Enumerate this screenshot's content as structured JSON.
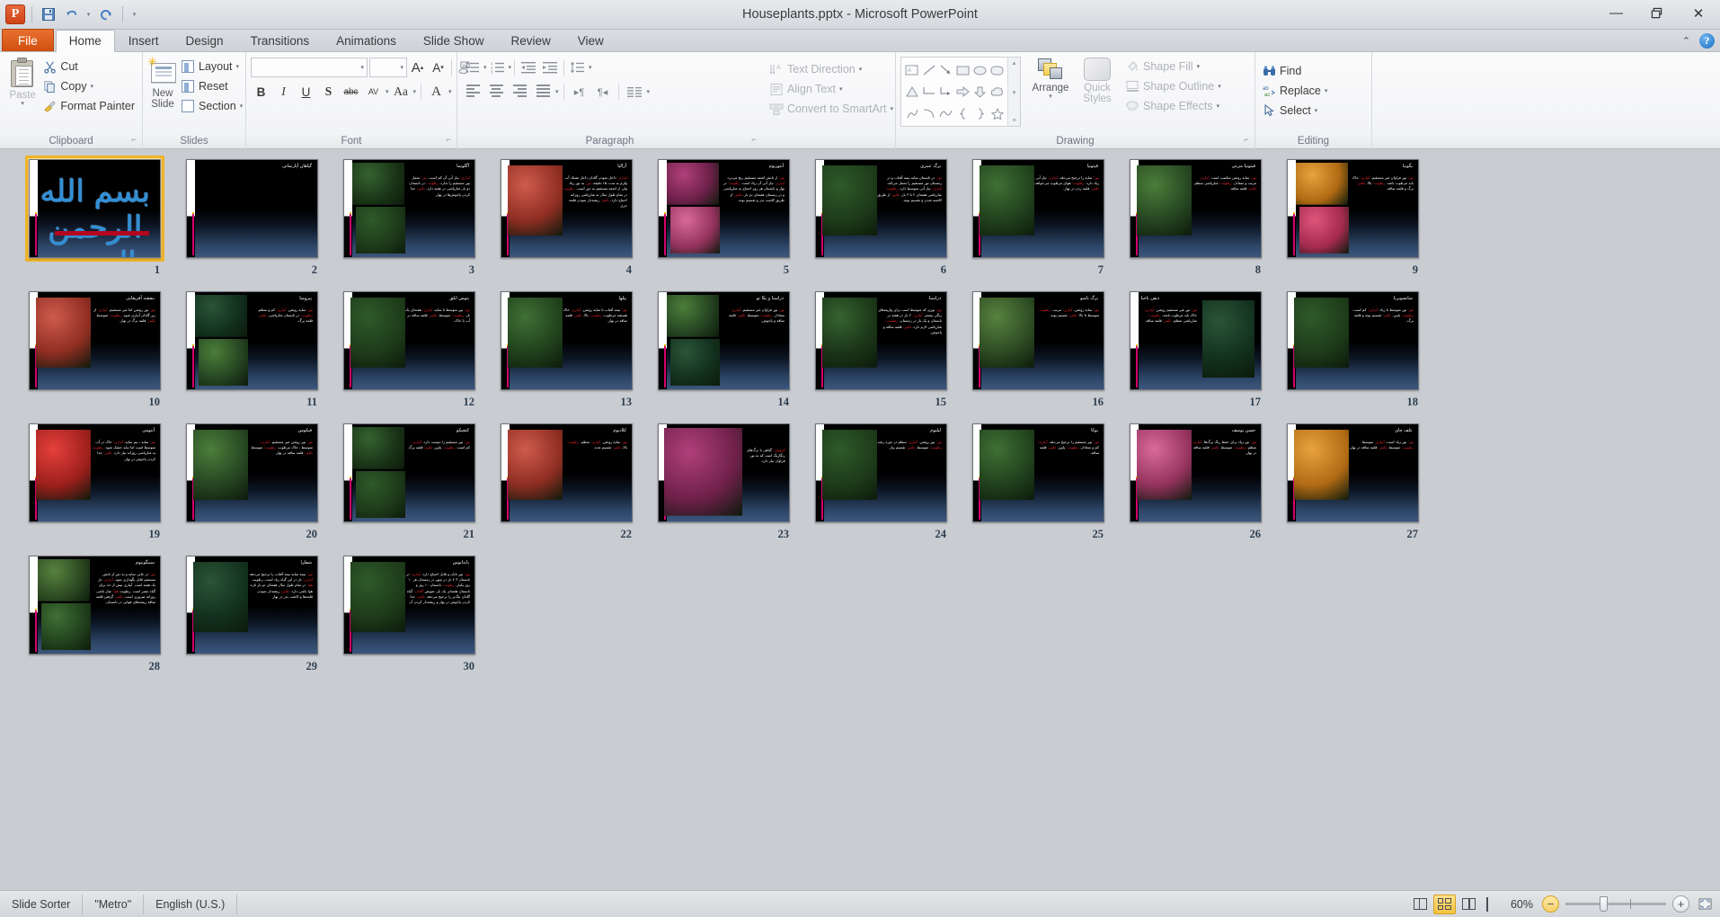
{
  "window": {
    "title": "Houseplants.pptx  -  Microsoft PowerPoint",
    "app_logo": "powerpoint-logo",
    "minimize": "—",
    "restore": "❐",
    "close": "✕",
    "collapse_ribbon": "⌃",
    "help": "?"
  },
  "quick_access": {
    "save": "save-icon",
    "undo": "↶",
    "undo_caret": "▾",
    "redo": "↻",
    "customize": "▾"
  },
  "tabs": [
    {
      "label": "File",
      "type": "file"
    },
    {
      "label": "Home",
      "type": "active"
    },
    {
      "label": "Insert",
      "type": "normal"
    },
    {
      "label": "Design",
      "type": "normal"
    },
    {
      "label": "Transitions",
      "type": "normal"
    },
    {
      "label": "Animations",
      "type": "normal"
    },
    {
      "label": "Slide Show",
      "type": "normal"
    },
    {
      "label": "Review",
      "type": "normal"
    },
    {
      "label": "View",
      "type": "normal"
    }
  ],
  "ribbon": {
    "clipboard": {
      "label": "Clipboard",
      "paste": "Paste",
      "paste_caret": "▾",
      "cut": "Cut",
      "copy": "Copy",
      "copy_caret": "▾",
      "format_painter": "Format Painter",
      "cut_icon": "scissors-icon",
      "copy_icon": "copy-icon",
      "painter_icon": "paintbrush-icon"
    },
    "slides": {
      "label": "Slides",
      "new_slide": "New",
      "new_slide_2": "Slide",
      "new_slide_caret": "▾",
      "layout": "Layout",
      "reset": "Reset",
      "section": "Section",
      "caret": "▾"
    },
    "font": {
      "label": "Font",
      "font_name_value": "",
      "font_size_value": "",
      "grow": "A",
      "shrink": "A",
      "clear_formatting": "clear-formatting-icon",
      "bold": "B",
      "italic": "I",
      "underline": "U",
      "shadow": "S",
      "strikethrough": "abc",
      "character_spacing": "AV",
      "change_case": "Aa",
      "font_color": "A",
      "caret": "▾"
    },
    "paragraph": {
      "label": "Paragraph",
      "bullets": "bullets-icon",
      "numbering": "numbering-icon",
      "decrease_indent": "decrease-indent-icon",
      "increase_indent": "increase-indent-icon",
      "line_spacing": "line-spacing-icon",
      "align_left": "align-left-icon",
      "align_center": "align-center-icon",
      "align_right": "align-right-icon",
      "justify": "justify-icon",
      "ltr": "▸¶",
      "rtl": "¶◂",
      "columns": "columns-icon",
      "text_direction": "Text Direction",
      "align_text": "Align Text",
      "convert_smartart": "Convert to SmartArt",
      "caret": "▾"
    },
    "drawing": {
      "label": "Drawing",
      "shapes": [
        "textbox",
        "line",
        "arrow",
        "rectangle",
        "oval",
        "rounded-rect",
        "triangle",
        "elbow-connector",
        "elbow-arrow",
        "right-arrow",
        "down-arrow",
        "cloud",
        "freeform",
        "arc",
        "curve",
        "left-brace",
        "right-brace",
        "star"
      ],
      "scroll_up": "▴",
      "scroll_down": "▾",
      "scroll_more": "≡",
      "arrange": "Arrange",
      "quick_styles_1": "Quick",
      "quick_styles_2": "Styles",
      "shape_fill": "Shape Fill",
      "shape_outline": "Shape Outline",
      "shape_effects": "Shape Effects",
      "caret": "▾"
    },
    "editing": {
      "label": "Editing",
      "find": "Find",
      "replace": "Replace",
      "select": "Select",
      "find_icon": "binoculars-icon",
      "replace_icon": "replace-icon",
      "select_icon": "pointer-icon",
      "caret": "▾"
    }
  },
  "status": {
    "view_mode": "Slide Sorter",
    "theme": "\"Metro\"",
    "language": "English (U.S.)",
    "zoom_level": "60%",
    "zoom_out": "−",
    "zoom_in": "+",
    "views": [
      {
        "name": "normal-view",
        "active": false
      },
      {
        "name": "slide-sorter-view",
        "active": true
      },
      {
        "name": "reading-view",
        "active": false
      },
      {
        "name": "slide-show-view",
        "active": false
      }
    ],
    "fit_to_window": "fit-slide-icon"
  },
  "presentation": {
    "selected_slide": 1,
    "slide_count": 30,
    "slides": [
      {
        "n": 1,
        "kind": "title",
        "title": "",
        "body": "",
        "hl": ""
      },
      {
        "n": 2,
        "kind": "plain",
        "title": "گیاهان آپارتمانی",
        "body": "",
        "hl": ""
      },
      {
        "n": 3,
        "kind": "twoimg",
        "title": "آگلونما",
        "body": "آبیاری: نیاز آبی آن کم است. نور: تحمل نور مستقیم را ندارد. رطوبت: در تابستان دو بار غبارپاشی در هفته دارد. تکثیر: جدا کردن پاجوش‌ها در بهار.",
        "hl": ""
      },
      {
        "n": 4,
        "kind": "leftimg",
        "title": "آزالیا",
        "body": "آبیاری: داخل نمودن گلدان داخل تشتک آب ولرم به مدت ۱۵ دقیقه. نور: به نور زیاد ولی از اشعه مستقیم به دور است. رطوبت: در تمام طول سال به غبارپاشی روزانه احتیاج دارد. تکثیر: ریشه‌دار نمودن قلمه جری",
        "hl": ""
      },
      {
        "n": 5,
        "kind": "twoimg",
        "title": "آنتوریوم",
        "body": "نور: از تابش اشعه مستقیم رنج می‌برد. آبیاری: نیاز آبی آن زیاد است. رطوبت: در بهار و تابستان هر روز احتیاج به غبارپاشی و در زمستان هفته‌ای دو بار. تکثیر: از طریق کاشت بذر و تقسیم بوته.",
        "hl": ""
      },
      {
        "n": 6,
        "kind": "leftimg",
        "title": "برگ عنبری",
        "body": "نور: در تابستان سایه نیمه آفتاب و در زمستان نور مستقیم را تحمل می‌کند. آبیاری: نیاز آبی متوسط دارد. رطوبت: غبارپاشی هفته‌ای ۲ تا ۳ بار. تکثیر: از طریق کاشته شدن و تقسیم بوته.",
        "hl": ""
      },
      {
        "n": 7,
        "kind": "leftimg",
        "title": "فیتونیا",
        "body": "نور: سایه را ترجیح می‌دهد. آبیاری: نیاز آبی زیاد دارد. رطوبت: هوای مرطوب می‌خواهد. تکثیر: قلمه زدن در بهار.",
        "hl": ""
      },
      {
        "n": 8,
        "kind": "leftimg",
        "title": "فیتونیا می‌نی",
        "body": "نور: سایه روشن مناسب است. آبیاری: مرتب و متعادل. رطوبت: غبارپاشی منظم. تکثیر: قلمه ساقه.",
        "hl": ""
      },
      {
        "n": 9,
        "kind": "twoimg",
        "title": "بگونیا",
        "body": "نور: نور فراوان غیر مستقیم. آبیاری: خاک باید مرطوب باشد. رطوبت: بالا. تکثیر: برگ و قلمه ساقه.",
        "hl": ""
      },
      {
        "n": 10,
        "kind": "leftimg",
        "title": "بنفشه آفریقایی",
        "body": "نور: نور روشن اما غیر مستقیم. آبیاری: از زیر گلدان آبیاری شود. رطوبت: متوسط. تکثیر: قلمه برگ در بهار.",
        "hl": ""
      },
      {
        "n": 11,
        "kind": "twoimg",
        "title": "پپرومیا",
        "body": "نور: سایه روشن. آبیاری: کم و منظم. رطوبت: در تابستان غبارپاشی. تکثیر: قلمه برگ.",
        "hl": ""
      },
      {
        "n": 12,
        "kind": "leftimg",
        "title": "پتوس ابلق",
        "body": "نور: نور متوسط تا سایه. آبیاری: هفته‌ای یک بار. رطوبت: متوسط. تکثیر: قلمه ساقه در آب یا خاک.",
        "hl": ""
      },
      {
        "n": 13,
        "kind": "leftimg",
        "title": "پیلها",
        "body": "نور: نیمه آفتاب تا سایه روشن. آبیاری: خاک همیشه مرطوب. رطوبت: بالا. تکثیر: قلمه ساقه در بهار.",
        "hl": ""
      },
      {
        "n": 14,
        "kind": "twoimg",
        "title": "دراسنا و یکا نو",
        "body": "نور: نور فراوان غیر مستقیم. آبیاری: متعادل. رطوبت: متوسط. تکثیر: قلمه ساقه و پاجوش.",
        "hl": ""
      },
      {
        "n": 15,
        "kind": "leftimg",
        "title": "دراسنا",
        "body": "نور: نوری که متوسط است برای واریته‌های رنگی بیشتر. آبیاری: ۲ بار در هفته در تابستان و یک بار در زمستان. رطوبت: غبارپاشی لازم دارد. تکثیر: قلمه ساقه و پاجوش.",
        "hl": ""
      },
      {
        "n": 16,
        "kind": "leftimg",
        "title": "برگ بامبو",
        "body": "نور: سایه روشن. آبیاری: مرتب. رطوبت: متوسط تا بالا. تکثیر: تقسیم بوته.",
        "hl": ""
      },
      {
        "n": 17,
        "kind": "right",
        "title": "دیفن باخیا",
        "body": "نور: نور غیر مستقیم روشن. آبیاری: خاک باید مرطوب باشد. رطوبت: غبارپاشی منظم. تکثیر: قلمه ساقه.",
        "hl": ""
      },
      {
        "n": 18,
        "kind": "leftimg",
        "title": "سانسویریا",
        "body": "نور: نور متوسط تا زیاد. آبیاری: کم است. رطوبت: پایین. تکثیر: تقسیم بوته و قلمه برگ.",
        "hl": ""
      },
      {
        "n": 19,
        "kind": "leftimg",
        "title": "آنتومی",
        "body": "نور: سایه ، نیم سایه. آبیاری: خاک در آب متوسط است اما نباید خشک شود. رطوبت: به غبارپاشی روزانه نیاز دارد. تکثیر: جدا کردن پاجوش در بهار.",
        "hl": ""
      },
      {
        "n": 20,
        "kind": "leftimg",
        "title": "فیکوس",
        "body": "نور: نور روشن غیر مستقیم. آبیاری: متوسط ، خاک مرطوب. رطوبت: متوسط. تکثیر: قلمه ساقه در بهار.",
        "hl": ""
      },
      {
        "n": 21,
        "kind": "twoimg",
        "title": "کتچیکو",
        "body": "نور: نور مستقیم را دوست دارد. آبیاری: کم است. رطوبت: پایین. تکثیر: قلمه برگ.",
        "hl": ""
      },
      {
        "n": 22,
        "kind": "leftimg",
        "title": "کلادیوم",
        "body": "نور: سایه روشن. آبیاری: منظم. رطوبت: بالا. تکثیر: تقسیم غده.",
        "hl": ""
      },
      {
        "n": 23,
        "kind": "bigimg",
        "title": "",
        "body": "کروتون: گیاهی با برگ‌های رنگارنگ است که به نور فراوان نیاز دارد.",
        "hl": ""
      },
      {
        "n": 24,
        "kind": "leftimg",
        "title": "لیلیوم",
        "body": "نور: نور روشن. آبیاری: منظم در دوره رشد. رطوبت: متوسط. تکثیر: تقسیم پیاز.",
        "hl": ""
      },
      {
        "n": 25,
        "kind": "leftimg",
        "title": "یوکا",
        "body": "نور: نور مستقیم را ترجیح می‌دهد. آبیاری: کم و متعادل. رطوبت: پایین. تکثیر: قلمه ساقه.",
        "hl": ""
      },
      {
        "n": 26,
        "kind": "leftimg",
        "title": "حسن یوسف",
        "body": "نور: نور زیاد برای حفظ رنگ برگ‌ها. آبیاری: منظم. رطوبت: متوسط. تکثیر: قلمه ساقه در بهار.",
        "hl": ""
      },
      {
        "n": 27,
        "kind": "leftimg",
        "title": "علف چای",
        "body": "نور: نور زیاد است. آبیاری: متوسط. رطوبت: متوسط. تکثیر: قلمه ساقه در بهار.",
        "hl": ""
      },
      {
        "n": 28,
        "kind": "twoimg",
        "title": "سینگونیوم",
        "body": "نور: در جایی سایه و به دور از تابش مستقیم قابل نگهداری نمود. آبیاری: بار یک هفته است. آبیاری بیش از حد برای گیاه مضر است. رطوبت هوا: غبار باشی روزانه ضروری است. تکثیر: گرفتن قلمه ساقه ریشه‌های هوایی در تابستان.",
        "hl": ""
      },
      {
        "n": 29,
        "kind": "leftimg",
        "title": "شفلرا",
        "body": "نور: نیمه سایه نیمه آفتاب را ترجیح می‌دهد. آبیاری: بار در این گیاه زیاد است. رطوبت هوا: در تمام طول سال هفته‌ای دو بار تازه هوا باشی دارد. تکثیر: ریشه‌دار نمودن قلمه‌ها و کاشت بذر در بهار",
        "hl": ""
      },
      {
        "n": 30,
        "kind": "leftimg",
        "title": "پاندانوس",
        "body": "نور: نور تابان و قابل احتیاج دارد. آبیاری: در تابستان ۳ ۴ بار در منهر در زمستان هر ۱۰ روز یکبار. رطوبت: تابستان ۱۰ روز و تابستان هفته‌ای یک بار. تعویض گلدان: گیاه گلدان تنگ‌تر را ترجیح می‌دهد. تکثیر: جدا کردن پاجوش در بهار و ریشه‌دار کردن آن",
        "hl": ""
      }
    ]
  }
}
